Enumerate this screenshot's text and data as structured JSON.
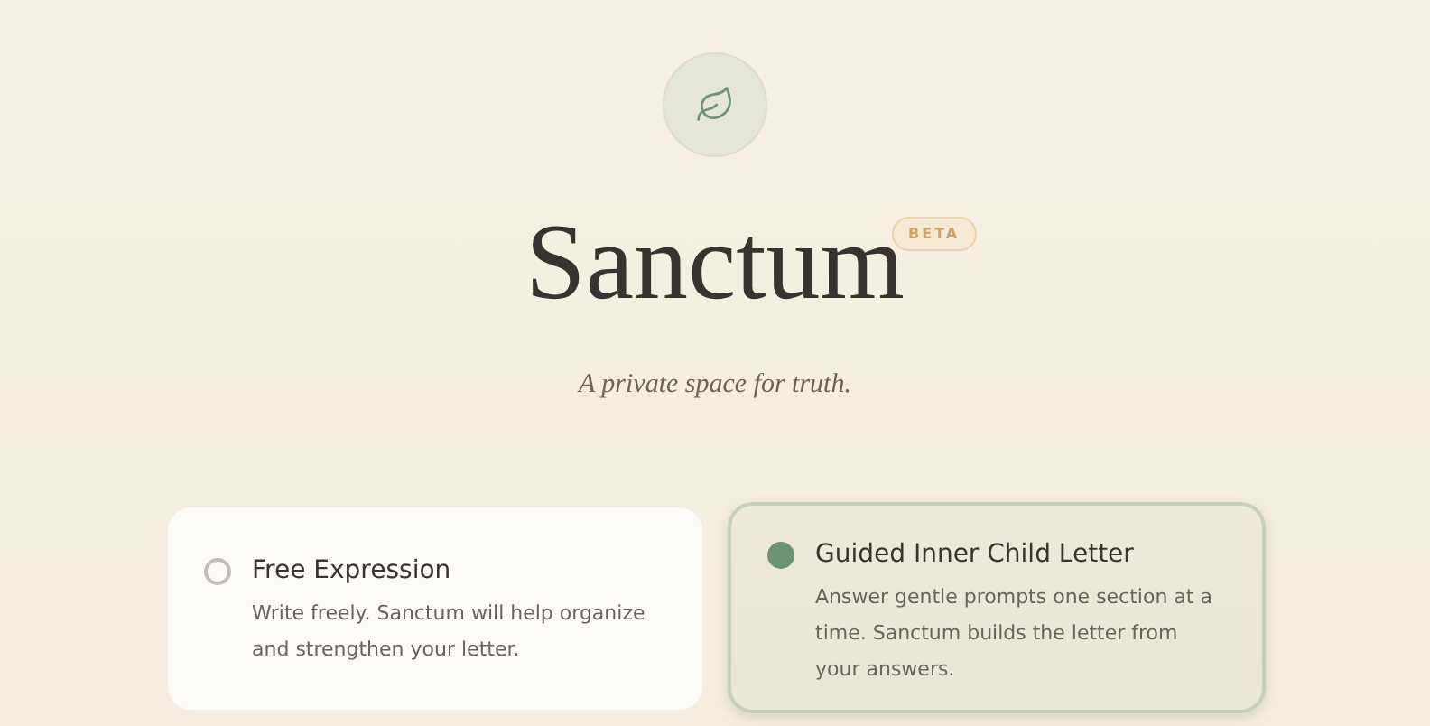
{
  "header": {
    "title": "Sanctum",
    "badge": "BETA",
    "tagline": "A private space for truth."
  },
  "modes": [
    {
      "title": "Free Expression",
      "description": "Write freely. Sanctum will help organize and strengthen your letter.",
      "selected": false
    },
    {
      "title": "Guided Inner Child Letter",
      "description": "Answer gentle prompts one section at a time. Sanctum builds the letter from your answers.",
      "selected": true
    }
  ]
}
